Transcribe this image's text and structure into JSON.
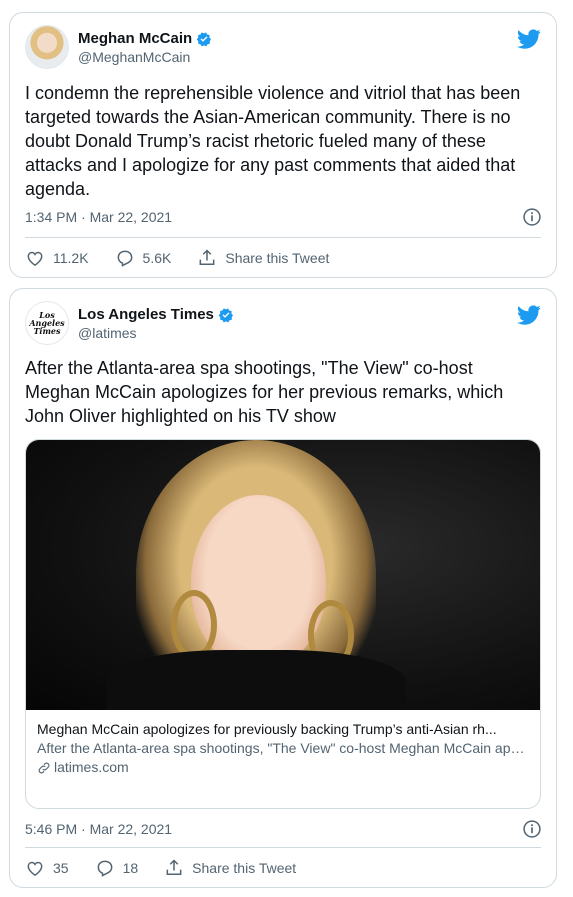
{
  "tweets": [
    {
      "author": {
        "display_name": "Meghan McCain",
        "handle": "@MeghanMcCain",
        "verified": true
      },
      "text": "I condemn the reprehensible violence and vitriol that has been targeted towards the Asian-American community. There is no doubt Donald Trump’s racist rhetoric fueled many of these attacks and I apologize for any past comments that aided that agenda.",
      "timestamp": "1:34 PM · Mar 22, 2021",
      "likes": "11.2K",
      "replies": "5.6K",
      "share_label": "Share this Tweet"
    },
    {
      "author": {
        "display_name": "Los Angeles Times",
        "handle": "@latimes",
        "verified": true,
        "logo_text": [
          "Los",
          "Angeles",
          "Times"
        ]
      },
      "text": "After the Atlanta-area spa shootings, \"The View\" co-host Meghan McCain apologizes for her previous remarks, which John Oliver highlighted on his TV show",
      "card": {
        "title": "Meghan McCain apologizes for previously backing Trump’s anti-Asian rh...",
        "description": "After the Atlanta-area spa shootings, \"The View\" co-host Meghan McCain apologizes for her previous remarks, which John Oliver highlighted on his...",
        "domain": "latimes.com"
      },
      "timestamp": "5:46 PM · Mar 22, 2021",
      "likes": "35",
      "replies": "18",
      "share_label": "Share this Tweet"
    }
  ],
  "colors": {
    "twitter_blue": "#1d9bf0",
    "secondary_text": "#536471",
    "border": "#cfd9de"
  },
  "icons": [
    "twitter-bird-icon",
    "verified-badge-icon",
    "info-icon",
    "heart-icon",
    "reply-icon",
    "share-icon",
    "link-icon"
  ]
}
